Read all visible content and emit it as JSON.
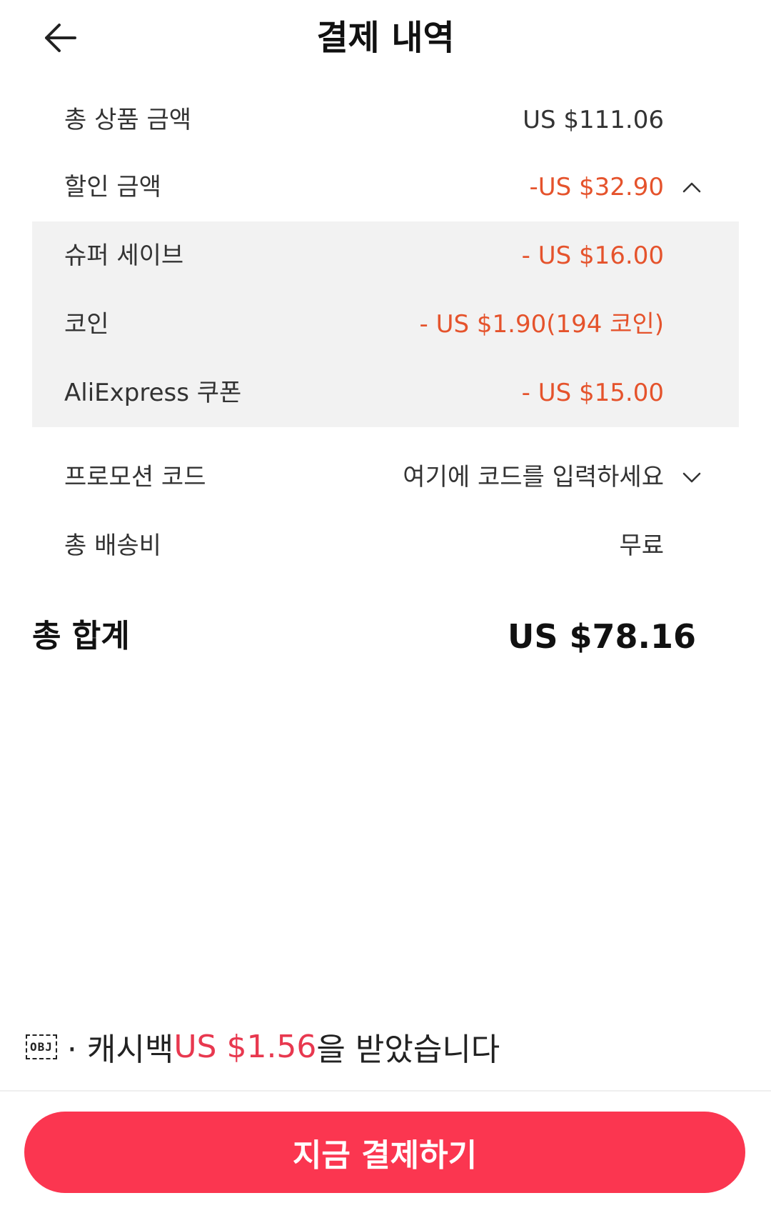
{
  "header": {
    "title": "결제 내역"
  },
  "summary": {
    "subtotal": {
      "label": "총 상품 금액",
      "value": "US $111.06"
    },
    "discount": {
      "label": "할인 금액",
      "value": "-US $32.90"
    },
    "discount_items": [
      {
        "label": "슈퍼 세이브",
        "value": "- US $16.00"
      },
      {
        "label": "코인",
        "value": "- US $1.90(194 코인)"
      },
      {
        "label": "AliExpress 쿠폰",
        "value": "- US $15.00"
      }
    ],
    "promo": {
      "label": "프로모션 코드",
      "placeholder": "여기에 코드를 입력하세요"
    },
    "shipping": {
      "label": "총 배송비",
      "value": "무료"
    },
    "total": {
      "label": "총 합계",
      "value": "US $78.16"
    }
  },
  "cashback": {
    "obj_text": "OBJ",
    "prefix": "· 캐시백 ",
    "amount": "US $1.56",
    "suffix": "을 받았습니다"
  },
  "actions": {
    "pay_label": "지금 결제하기"
  },
  "colors": {
    "accent": "#fb3650",
    "discount_red": "#e5532c",
    "cashback_red": "#e8384f",
    "panel_bg": "#f2f2f2"
  },
  "icons": {
    "back": "arrow-left-icon",
    "discount_toggle": "chevron-up-icon",
    "promo_toggle": "chevron-down-icon"
  }
}
